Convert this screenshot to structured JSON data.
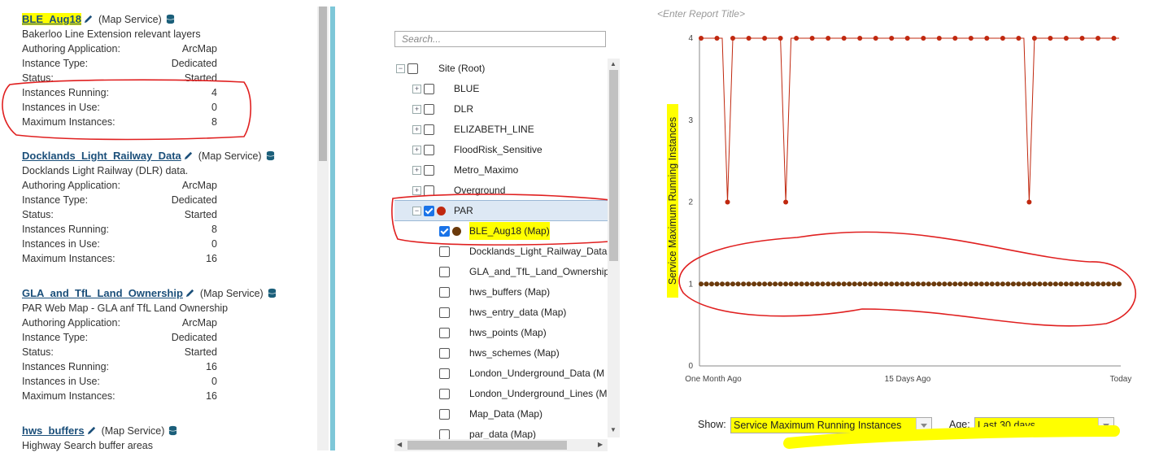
{
  "services": [
    {
      "name": "BLE_Aug18",
      "type": "(Map Service)",
      "desc": "Bakerloo Line Extension relevant layers",
      "props": [
        [
          "Authoring Application:",
          "ArcMap"
        ],
        [
          "Instance Type:",
          "Dedicated"
        ],
        [
          "Status:",
          "Started"
        ],
        [
          "Instances Running:",
          "4"
        ],
        [
          "Instances in Use:",
          "0"
        ],
        [
          "Maximum Instances:",
          "8"
        ]
      ]
    },
    {
      "name": "Docklands_Light_Railway_Data",
      "type": "(Map Service)",
      "desc": "Docklands Light Railway (DLR) data.",
      "props": [
        [
          "Authoring Application:",
          "ArcMap"
        ],
        [
          "Instance Type:",
          "Dedicated"
        ],
        [
          "Status:",
          "Started"
        ],
        [
          "Instances Running:",
          "8"
        ],
        [
          "Instances in Use:",
          "0"
        ],
        [
          "Maximum Instances:",
          "16"
        ]
      ]
    },
    {
      "name": "GLA_and_TfL_Land_Ownership",
      "type": "(Map Service)",
      "desc": "PAR Web Map - GLA anf TfL Land Ownership",
      "props": [
        [
          "Authoring Application:",
          "ArcMap"
        ],
        [
          "Instance Type:",
          "Dedicated"
        ],
        [
          "Status:",
          "Started"
        ],
        [
          "Instances Running:",
          "16"
        ],
        [
          "Instances in Use:",
          "0"
        ],
        [
          "Maximum Instances:",
          "16"
        ]
      ]
    },
    {
      "name": "hws_buffers",
      "type": "(Map Service)",
      "desc": "Highway Search buffer areas",
      "props": []
    }
  ],
  "tree": {
    "search_placeholder": "Search...",
    "root": "Site (Root)",
    "folders": [
      "BLUE",
      "DLR",
      "ELIZABETH_LINE",
      "FloodRisk_Sensitive",
      "Metro_Maximo",
      "Overground",
      "PAR"
    ],
    "par_children": [
      "BLE_Aug18 (Map)",
      "Docklands_Light_Railway_Data",
      "GLA_and_TfL_Land_Ownership",
      "hws_buffers (Map)",
      "hws_entry_data (Map)",
      "hws_points (Map)",
      "hws_schemes (Map)",
      "London_Underground_Data (M",
      "London_Underground_Lines (M",
      "Map_Data (Map)",
      "par_data (Map)"
    ]
  },
  "report": {
    "title_placeholder": "<Enter Report Title>",
    "show_label": "Show:",
    "show_value": "Service Maximum Running Instances",
    "age_label": "Age:",
    "age_value": "Last 30 days"
  },
  "chart_data": {
    "type": "line",
    "ylabel": "Service Maximum Running Instances",
    "x_tick_labels": [
      "One Month Ago",
      "15 Days Ago",
      "Today"
    ],
    "ylim": [
      0,
      4
    ],
    "y_ticks": [
      0,
      1,
      2,
      3,
      4
    ],
    "series": [
      {
        "name": "PAR",
        "color": "#c0280f",
        "values": [
          4,
          4,
          4,
          4,
          4,
          2,
          4,
          4,
          4,
          4,
          4,
          4,
          4,
          4,
          4,
          4,
          2,
          4,
          4,
          4,
          4,
          4,
          4,
          4,
          4,
          4,
          4,
          4,
          4,
          4,
          4,
          4,
          4,
          4,
          4,
          4,
          4,
          4,
          4,
          4,
          4,
          4,
          4,
          4,
          4,
          4,
          4,
          4,
          4,
          4,
          4,
          4,
          4,
          4,
          4,
          4,
          4,
          4,
          4,
          4,
          4,
          4,
          2,
          4,
          4,
          4,
          4,
          4,
          4,
          4,
          4,
          4,
          4,
          4,
          4,
          4,
          4,
          4,
          4,
          4
        ]
      },
      {
        "name": "BLE_Aug18 (Map)",
        "color": "#6b3a0c",
        "values": [
          1,
          1,
          1,
          1,
          1,
          1,
          1,
          1,
          1,
          1,
          1,
          1,
          1,
          1,
          1,
          1,
          1,
          1,
          1,
          1,
          1,
          1,
          1,
          1,
          1,
          1,
          1,
          1,
          1,
          1,
          1,
          1,
          1,
          1,
          1,
          1,
          1,
          1,
          1,
          1,
          1,
          1,
          1,
          1,
          1,
          1,
          1,
          1,
          1,
          1,
          1,
          1,
          1,
          1,
          1,
          1,
          1,
          1,
          1,
          1,
          1,
          1,
          1,
          1,
          1,
          1,
          1,
          1,
          1,
          1,
          1,
          1,
          1,
          1,
          1,
          1,
          1,
          1,
          1,
          1
        ]
      }
    ]
  }
}
